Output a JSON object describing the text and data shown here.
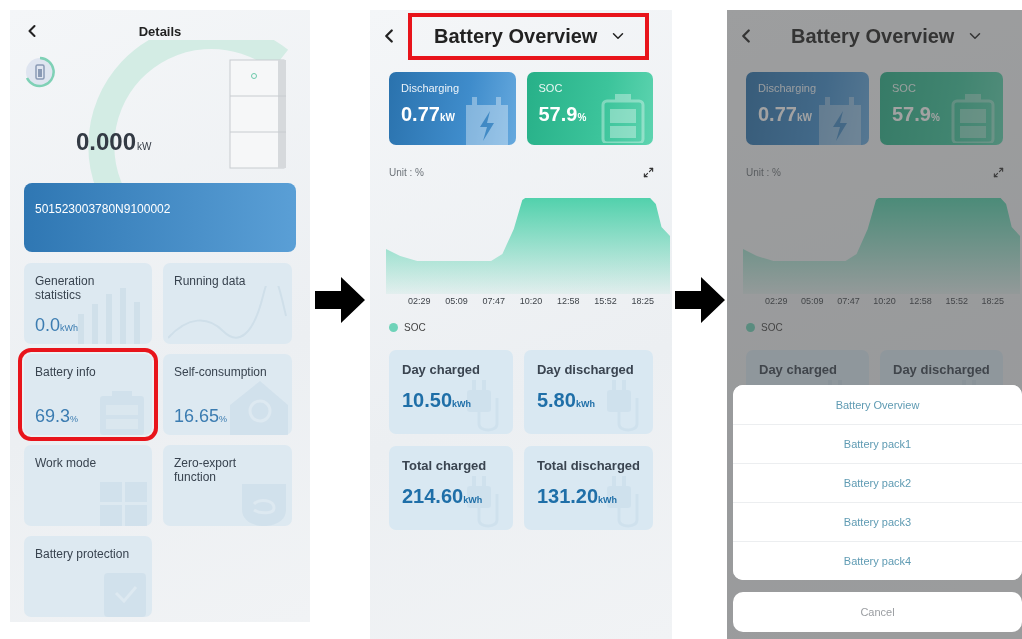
{
  "screens": [
    {
      "kind": "details",
      "title": "Details",
      "power": {
        "value": "0.000",
        "unit": "kW"
      },
      "serial": "501523003780N9100002",
      "tiles": [
        {
          "label": "Generation statistics",
          "value": "0.0",
          "unit": "kWh",
          "highlighted": false
        },
        {
          "label": "Running data",
          "highlighted": false
        },
        {
          "label": "Battery info",
          "value": "69.3",
          "unit": "%",
          "highlighted": true
        },
        {
          "label": "Self-consumption",
          "value": "16.65",
          "unit": "%",
          "highlighted": false
        },
        {
          "label": "Work mode",
          "highlighted": false
        },
        {
          "label": "Zero-export function",
          "highlighted": false
        },
        {
          "label": "Battery protection",
          "highlighted": false
        }
      ]
    },
    {
      "kind": "overview",
      "title": "Battery Overview",
      "highlighted": true,
      "dimmed": false,
      "status_cards": [
        {
          "kind": "discharging",
          "label": "Discharging",
          "value": "0.77",
          "unit": "kW"
        },
        {
          "kind": "soc",
          "label": "SOC",
          "value": "57.9",
          "unit": "%"
        }
      ],
      "unit_label": "Unit : %",
      "x_labels": [
        "02:29",
        "05:09",
        "07:47",
        "10:20",
        "12:58",
        "15:52",
        "18:25"
      ],
      "legend": "SOC",
      "stats": [
        {
          "label": "Day charged",
          "value": "10.50",
          "unit": "kWh"
        },
        {
          "label": "Day discharged",
          "value": "5.80",
          "unit": "kWh"
        },
        {
          "label": "Total charged",
          "value": "214.60",
          "unit": "kWh"
        },
        {
          "label": "Total discharged",
          "value": "131.20",
          "unit": "kWh"
        }
      ]
    },
    {
      "kind": "overview",
      "title": "Battery Overview",
      "highlighted": false,
      "dimmed": true,
      "status_cards": [
        {
          "kind": "discharging",
          "label": "Discharging",
          "value": "0.77",
          "unit": "kW"
        },
        {
          "kind": "soc",
          "label": "SOC",
          "value": "57.9",
          "unit": "%"
        }
      ],
      "unit_label": "Unit : %",
      "x_labels": [
        "02:29",
        "05:09",
        "07:47",
        "10:20",
        "12:58",
        "15:52",
        "18:25"
      ],
      "legend": "SOC",
      "stats": [
        {
          "label": "Day charged"
        },
        {
          "label": "Day discharged"
        }
      ],
      "action_sheet": {
        "options": [
          "Battery Overview",
          "Battery pack1",
          "Battery pack2",
          "Battery pack3",
          "Battery pack4"
        ],
        "cancel": "Cancel"
      }
    }
  ]
}
